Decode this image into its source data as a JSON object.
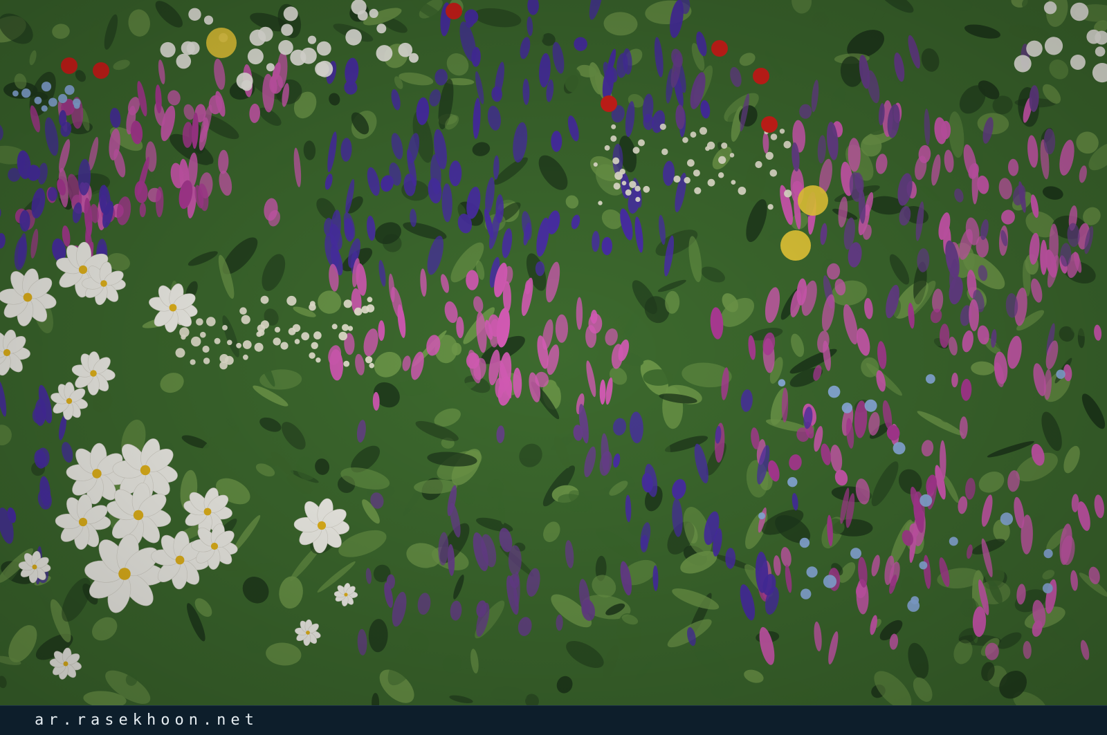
{
  "photo": {
    "subject": "flower-meadow",
    "palette": {
      "foliage_dark": "#1f3a1c",
      "foliage_mid": "#3d6a2e",
      "foliage_light": "#6f9a4a",
      "white_cosmos": "#f6f5ee",
      "cosmos_center": "#e8b81c",
      "pink_salvia": "#d45bb5",
      "magenta_salvia": "#b03a98",
      "violet_salvia": "#4a2fa8",
      "purple_agastache": "#6a3f8f",
      "blue_nigella": "#8fb3e6",
      "red_zinnia": "#d4201a",
      "yellow_bloom": "#f2d23a",
      "daisy_white": "#ece8d6"
    }
  },
  "watermark": {
    "text": "ar.rasekhoon.net",
    "color": "#e6edf2",
    "bar_color": "#0d1e2b"
  }
}
